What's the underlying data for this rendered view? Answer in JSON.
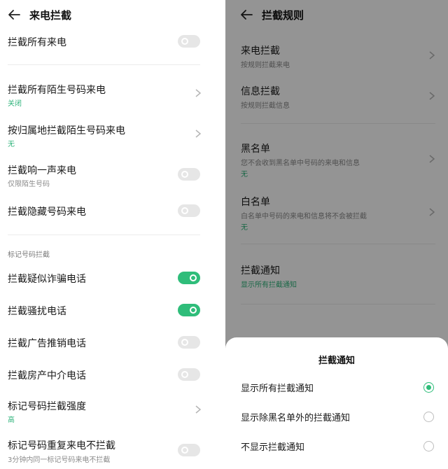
{
  "left": {
    "header": {
      "title": "来电拦截",
      "back_icon": "arrow-left-icon"
    },
    "rows": [
      {
        "title": "拦截所有来电",
        "toggle": false
      },
      {
        "title": "拦截所有陌生号码来电",
        "sub": "关闭"
      },
      {
        "title": "按归属地拦截陌生号码来电",
        "sub": "无"
      },
      {
        "title": "拦截响一声来电",
        "sub": "仅限陌生号码",
        "toggle": false
      },
      {
        "title": "拦截隐藏号码来电",
        "toggle": false
      },
      {
        "title": "拦截疑似诈骗电话",
        "toggle": true
      },
      {
        "title": "拦截骚扰电话",
        "toggle": true
      },
      {
        "title": "拦截广告推销电话",
        "toggle": false
      },
      {
        "title": "拦截房产中介电话",
        "toggle": false
      },
      {
        "title": "标记号码拦截强度",
        "sub": "高"
      },
      {
        "title": "标记号码重复来电不拦截",
        "sub": "3分钟内同一标记号码来电不拦截",
        "toggle": false
      }
    ],
    "section_label": "标记号码拦截"
  },
  "right": {
    "header": {
      "title": "拦截规则",
      "back_icon": "arrow-left-icon"
    },
    "rows": [
      {
        "title": "来电拦截",
        "sub": "按规则拦截来电"
      },
      {
        "title": "信息拦截",
        "sub": "按规则拦截信息"
      },
      {
        "title": "黑名单",
        "sub": "您不会收到黑名单中号码的来电和信息",
        "sub2": "无"
      },
      {
        "title": "白名单",
        "sub": "白名单中号码的来电和信息将不会被拦截",
        "sub2": "无"
      },
      {
        "title": "拦截通知",
        "sub": "显示所有拦截通知"
      }
    ],
    "sheet": {
      "title": "拦截通知",
      "options": [
        {
          "label": "显示所有拦截通知",
          "selected": true
        },
        {
          "label": "显示除黑名单外的拦截通知",
          "selected": false
        },
        {
          "label": "不显示拦截通知",
          "selected": false
        }
      ]
    }
  },
  "colors": {
    "accent": "#2fbd7a",
    "accent_text": "#2fb37b",
    "toggle_off": "#e6e6e6",
    "overlay": "rgba(0,0,0,0.42)"
  }
}
